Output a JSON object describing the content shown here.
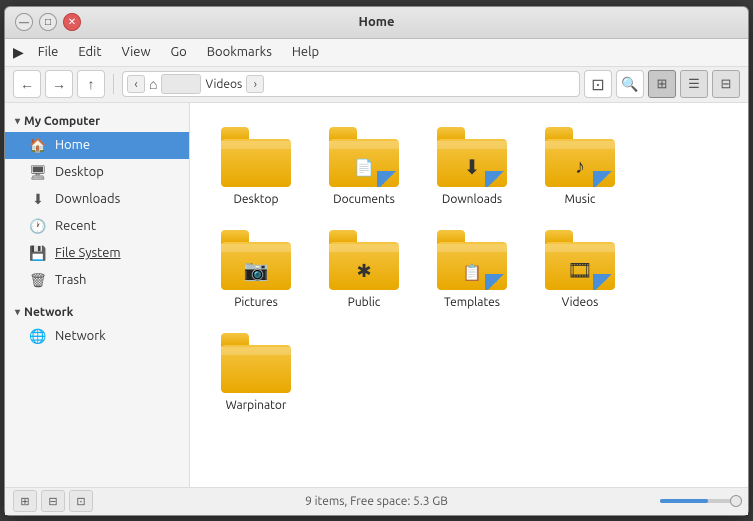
{
  "window": {
    "title": "Home",
    "controls": {
      "minimize": "—",
      "maximize": "□",
      "close": "✕"
    }
  },
  "menubar": {
    "items": [
      "File",
      "Edit",
      "View",
      "Go",
      "Bookmarks",
      "Help"
    ]
  },
  "toolbar": {
    "back_arrow": "←",
    "forward_arrow": "→",
    "up_arrow": "↑",
    "left_nav": "‹",
    "right_nav": "›",
    "home_icon": "⌂",
    "path_label": "",
    "breadcrumb_label": "Videos",
    "search_icon": "🔍",
    "zoom_icon": "⊞",
    "list_icon": "☰",
    "details_icon": "⊟",
    "view_icon": "▦"
  },
  "sidebar": {
    "my_computer_label": "My Computer",
    "items_computer": [
      {
        "id": "home",
        "label": "Home",
        "icon": "🏠",
        "active": true
      },
      {
        "id": "desktop",
        "label": "Desktop",
        "icon": "🖥"
      },
      {
        "id": "downloads",
        "label": "Downloads",
        "icon": "⬇"
      },
      {
        "id": "recent",
        "label": "Recent",
        "icon": "🕐"
      },
      {
        "id": "filesystem",
        "label": "File System",
        "icon": "💾",
        "underline": true
      },
      {
        "id": "trash",
        "label": "Trash",
        "icon": "🗑"
      }
    ],
    "network_label": "Network",
    "items_network": [
      {
        "id": "network",
        "label": "Network",
        "icon": "🌐"
      }
    ]
  },
  "files": [
    {
      "id": "desktop",
      "name": "Desktop",
      "icon": "folder",
      "overlay": ""
    },
    {
      "id": "documents",
      "name": "Documents",
      "icon": "folder",
      "overlay": "📄"
    },
    {
      "id": "downloads",
      "name": "Downloads",
      "icon": "folder",
      "overlay": "⬇"
    },
    {
      "id": "music",
      "name": "Music",
      "icon": "folder",
      "overlay": "♪"
    },
    {
      "id": "pictures",
      "name": "Pictures",
      "icon": "folder",
      "overlay": "📷"
    },
    {
      "id": "public",
      "name": "Public",
      "icon": "folder",
      "overlay": "✱"
    },
    {
      "id": "templates",
      "name": "Templates",
      "icon": "folder",
      "overlay": "📋"
    },
    {
      "id": "videos",
      "name": "Videos",
      "icon": "folder",
      "overlay": "🎞"
    },
    {
      "id": "warpinator",
      "name": "Warpinator",
      "icon": "folder",
      "overlay": ""
    }
  ],
  "statusbar": {
    "text": "9 items, Free space: 5.3 GB",
    "zoom_level": 60
  }
}
